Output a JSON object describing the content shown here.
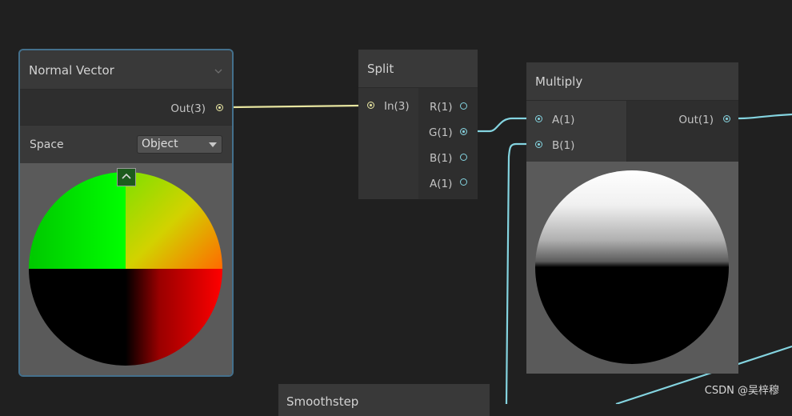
{
  "nodes": {
    "normal_vector": {
      "title": "Normal Vector",
      "output_label": "Out(3)",
      "space_label": "Space",
      "space_value": "Object"
    },
    "split": {
      "title": "Split",
      "input_label": "In(3)",
      "outputs": [
        "R(1)",
        "G(1)",
        "B(1)",
        "A(1)"
      ]
    },
    "multiply": {
      "title": "Multiply",
      "inputs": [
        "A(1)",
        "B(1)"
      ],
      "output_label": "Out(1)"
    },
    "smoothstep": {
      "title": "Smoothstep"
    }
  },
  "watermark": "CSDN @吴梓穆",
  "colors": {
    "background": "#202020",
    "node": "#393939",
    "selected_border": "#44708c",
    "vector3_wire": "#e7e5a0",
    "float_wire": "#84d4e0"
  },
  "icons": {
    "collapse": "chevron-down-icon",
    "preview_toggle": "chevron-up-icon",
    "dropdown": "dropdown-arrow-icon"
  }
}
